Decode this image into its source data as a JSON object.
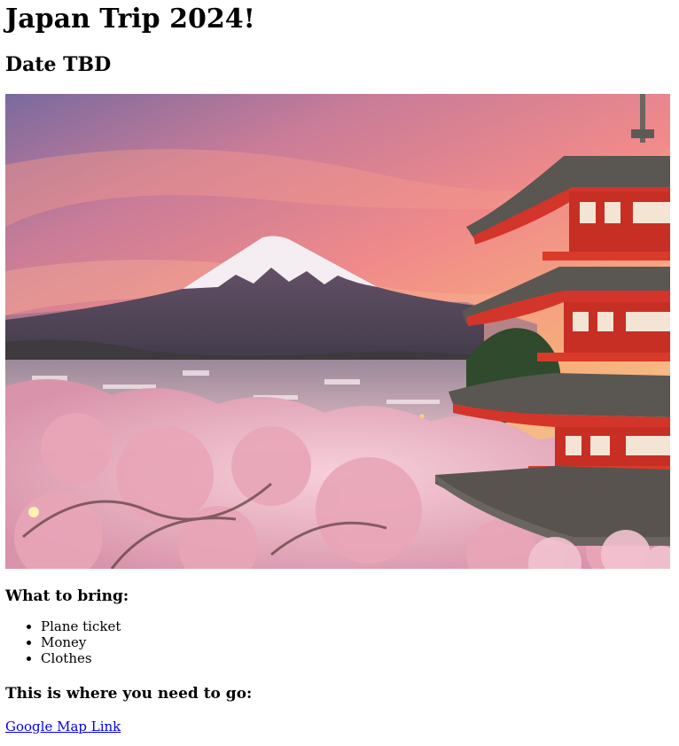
{
  "page": {
    "title": "Japan Trip 2024!",
    "subtitle": "Date TBD"
  },
  "hero_image": {
    "alt": "Mount Fuji with Chureito pagoda and cherry blossoms at sunset",
    "colors": {
      "sky_top": "#7a6a9e",
      "sky_mid": "#f08a8a",
      "sky_glow": "#f7b07a",
      "mountain": "#5e4a5e",
      "snow": "#f4eef2",
      "blossom": "#f0b8c8",
      "pagoda_red": "#d3352a",
      "roof": "#5a5652"
    }
  },
  "bring_section": {
    "heading": "What to bring:",
    "items": [
      {
        "label": "Plane ticket"
      },
      {
        "label": "Money"
      },
      {
        "label": "Clothes"
      }
    ]
  },
  "destination_section": {
    "heading": "This is where you need to go:",
    "link_label": "Google Map Link"
  }
}
